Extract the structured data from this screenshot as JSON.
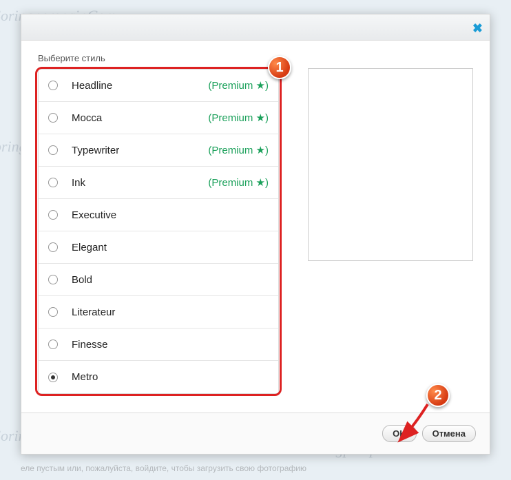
{
  "watermark_text": "Soringperepair.Com",
  "modal": {
    "select_label": "Выберите стиль",
    "styles": [
      {
        "name": "Headline",
        "premium": true,
        "selected": false
      },
      {
        "name": "Mocca",
        "premium": true,
        "selected": false
      },
      {
        "name": "Typewriter",
        "premium": true,
        "selected": false
      },
      {
        "name": "Ink",
        "premium": true,
        "selected": false
      },
      {
        "name": "Executive",
        "premium": false,
        "selected": false
      },
      {
        "name": "Elegant",
        "premium": false,
        "selected": false
      },
      {
        "name": "Bold",
        "premium": false,
        "selected": false
      },
      {
        "name": "Literateur",
        "premium": false,
        "selected": false
      },
      {
        "name": "Finesse",
        "premium": false,
        "selected": false
      },
      {
        "name": "Metro",
        "premium": false,
        "selected": true
      }
    ],
    "premium_label": "(Premium ★)",
    "ok_label": "OK",
    "cancel_label": "Отмена"
  },
  "markers": {
    "one": "1",
    "two": "2"
  },
  "bottom_text": "еле пустым или, пожалуйста, войдите, чтобы загрузить свою фотографию"
}
